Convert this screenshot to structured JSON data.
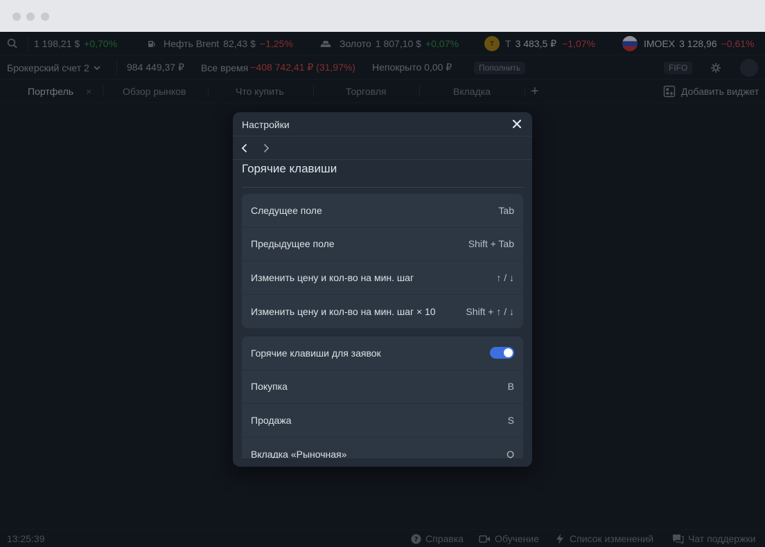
{
  "window": {
    "controls": [
      "close",
      "minimize",
      "maximize"
    ]
  },
  "ticker": {
    "gold_usd": {
      "price": "1 198,21 $",
      "change": "+0,70%"
    },
    "brent": {
      "name": "Нефть Brent",
      "price": "82,43 $",
      "change": "−1,25%"
    },
    "gold": {
      "name": "Золото",
      "price": "1 807,10 $",
      "change": "+0,07%"
    },
    "tcs": {
      "ticker": "T",
      "logo_text": "T",
      "price": "3 483,5 ₽",
      "change": "−1,07%"
    },
    "imoex": {
      "name": "IMOEX",
      "price": "3 128,96",
      "change": "−0,61%"
    }
  },
  "account": {
    "name": "Брокерский счет 2",
    "balance": "984 449,37 ₽",
    "all_time_label": "Все время",
    "all_time_value": "−408 742,41 ₽ (31,97%)",
    "uncovered": "Непокрыто 0,00 ₽",
    "topup_label": "Пополнить",
    "fifo_label": "FIFO"
  },
  "tabs": {
    "items": [
      "Портфель",
      "Обзор рынков",
      "Что купить",
      "Торговля",
      "Вкладка"
    ],
    "close_symbol": "×",
    "add_symbol": "+",
    "add_widget": "Добавить виджет"
  },
  "modal": {
    "title": "Настройки",
    "section_title": "Горячие клавиши",
    "navigation_rows": [
      {
        "label": "Следущее поле",
        "key": "Tab"
      },
      {
        "label": "Предыдущее поле",
        "key": "Shift + Tab"
      },
      {
        "label": "Изменить цену и кол-во на мин. шаг",
        "key": "↑ / ↓"
      },
      {
        "label": "Изменить цену и кол-во на мин. шаг × 10",
        "key": "Shift + ↑ / ↓"
      }
    ],
    "order_hotkeys": {
      "toggle_label": "Горячие клавиши для заявок",
      "toggle_on": true,
      "rows": [
        {
          "label": "Покупка",
          "key": "B"
        },
        {
          "label": "Продажа",
          "key": "S"
        },
        {
          "label": "Вкладка «Рыночная»",
          "key": "Q"
        }
      ]
    }
  },
  "status": {
    "time": "13:25:39",
    "help": "Справка",
    "learning": "Обучение",
    "changelog": "Список изменений",
    "support": "Чат поддержки"
  },
  "colors": {
    "background": "#141a22",
    "modal": "#232c37",
    "card": "#2d3743",
    "positive": "#30a046",
    "negative": "#e84a48",
    "toggle_accent": "#3d6fe0"
  },
  "icons": [
    "search-icon",
    "fuel-icon",
    "gold-bars-icon",
    "tcs-logo",
    "russia-flag-icon",
    "chevron-down-icon",
    "settings-icon",
    "add-widget-icon",
    "close-icon",
    "chevron-left-icon",
    "chevron-right-icon",
    "help-icon",
    "video-icon",
    "lightning-icon",
    "chat-icon"
  ]
}
